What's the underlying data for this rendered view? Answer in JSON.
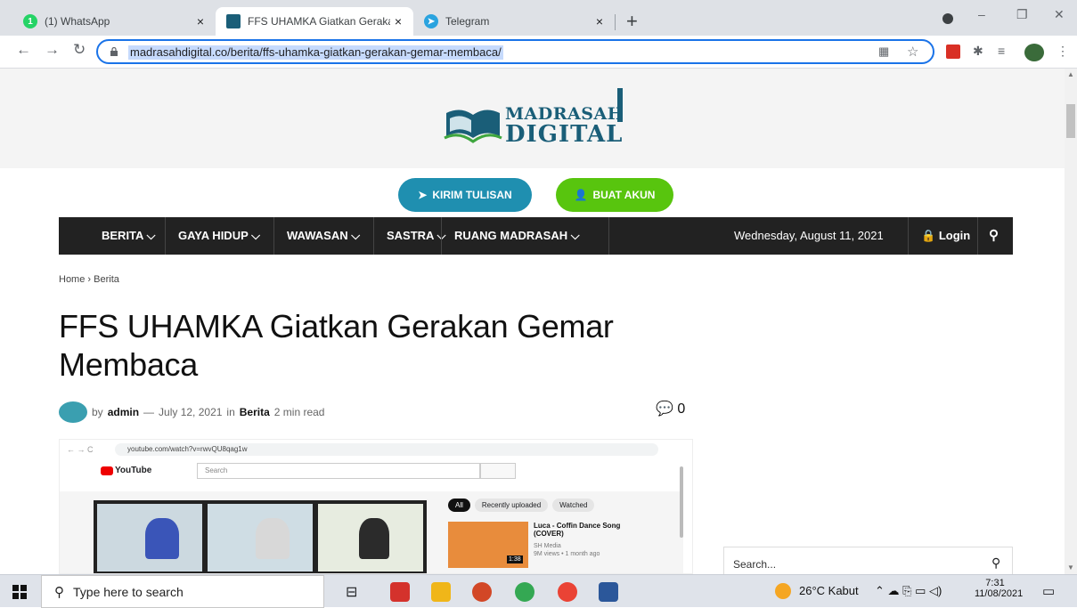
{
  "browser": {
    "tabs": [
      {
        "label": "(1) WhatsApp",
        "badge": "1",
        "close": "×"
      },
      {
        "label": "FFS UHAMKA Giatkan Gerakan G",
        "close": "×"
      },
      {
        "label": "Telegram",
        "close": "×"
      }
    ],
    "new_tab": "+",
    "window_controls": {
      "minimize": "–",
      "restore": "❐",
      "close": "✕"
    },
    "url": "madrasahdigital.co/berita/ffs-uhamka-giatkan-gerakan-gemar-membaca/"
  },
  "site": {
    "logo_line1": "MADRASAH",
    "logo_line2": "DIGITAL",
    "buttons": {
      "submit": "KIRIM TULISAN",
      "register": "BUAT AKUN"
    },
    "colors": {
      "submit": "#1f8fb0",
      "register": "#58c50e",
      "logo_blue": "#1a5e78"
    },
    "nav": [
      {
        "label": "BERITA"
      },
      {
        "label": "GAYA HIDUP"
      },
      {
        "label": "WAWASAN"
      },
      {
        "label": "SASTRA"
      },
      {
        "label": "RUANG MADRASAH"
      }
    ],
    "date": "Wednesday, August 11, 2021",
    "login": "Login"
  },
  "breadcrumb": {
    "home": "Home",
    "sep": "›",
    "current": "Berita"
  },
  "article": {
    "title": "FFS UHAMKA Giatkan Gerakan Gemar Membaca",
    "by": "by",
    "author": "admin",
    "dash": "—",
    "date": "July 12, 2021",
    "in": "in",
    "category": "Berita",
    "read_time": "2 min read",
    "comments": "0"
  },
  "embedded": {
    "url": "youtube.com/watch?v=rwvQU8qag1w",
    "search_placeholder": "Search",
    "chips": [
      "All",
      "Recently uploaded",
      "Watched"
    ],
    "video_title": "Luca - Coffin Dance Song (COVER)",
    "video_channel": "SH Media",
    "video_stats": "9M views • 1 month ago",
    "video_duration": "1:38"
  },
  "sidebar": {
    "search_placeholder": "Search..."
  },
  "taskbar": {
    "search_placeholder": "Type here to search",
    "weather": "26°C Kabut",
    "time": "7:31",
    "date": "11/08/2021"
  }
}
